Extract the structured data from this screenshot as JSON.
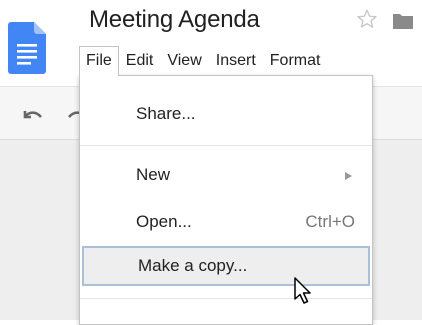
{
  "document": {
    "title": "Meeting Agenda"
  },
  "menubar": {
    "items": [
      {
        "label": "File",
        "active": true
      },
      {
        "label": "Edit",
        "active": false
      },
      {
        "label": "View",
        "active": false
      },
      {
        "label": "Insert",
        "active": false
      },
      {
        "label": "Format",
        "active": false
      }
    ]
  },
  "file_menu": {
    "share": {
      "label": "Share..."
    },
    "new": {
      "label": "New",
      "has_submenu": true
    },
    "open": {
      "label": "Open...",
      "shortcut": "Ctrl+O"
    },
    "make_copy": {
      "label": "Make a copy...",
      "highlighted": true
    }
  },
  "icons": {
    "app_logo": "google-docs-icon",
    "star": "star-icon",
    "folder": "folder-icon",
    "undo": "undo-icon",
    "redo": "redo-icon",
    "cursor": "mouse-pointer-icon"
  },
  "colors": {
    "docs_blue": "#4285f4",
    "highlight_border": "#a9bfdc",
    "highlight_bg": "#eeeeee"
  }
}
